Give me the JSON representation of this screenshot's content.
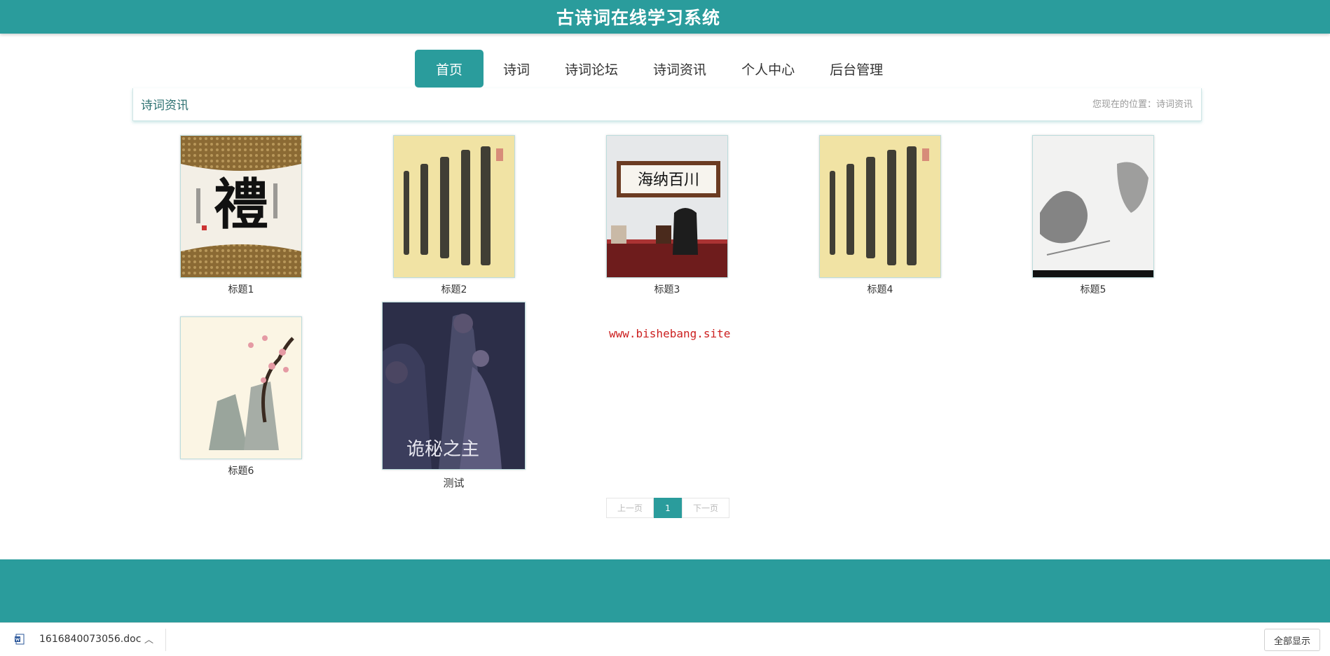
{
  "header": {
    "title": "古诗词在线学习系统"
  },
  "nav": {
    "items": [
      {
        "label": "首页"
      },
      {
        "label": "诗词"
      },
      {
        "label": "诗词论坛"
      },
      {
        "label": "诗词资讯"
      },
      {
        "label": "个人中心"
      },
      {
        "label": "后台管理"
      }
    ]
  },
  "breadcrumb": {
    "title": "诗词资讯",
    "path": "您现在的位置：诗词资讯"
  },
  "cards": [
    {
      "caption": "标题1",
      "image": "calligraphy-li-scroll"
    },
    {
      "caption": "标题2",
      "image": "calligraphy-yellow-scroll"
    },
    {
      "caption": "标题3",
      "image": "office-calligraphy-wall"
    },
    {
      "caption": "标题4",
      "image": "calligraphy-yellow-scroll"
    },
    {
      "caption": "标题5",
      "image": "ink-landscape-painting"
    },
    {
      "caption": "标题6",
      "image": "ink-plum-blossom-painting"
    },
    {
      "caption": "测试",
      "image": "anime-cover",
      "overlay_text": "诡秘之主"
    }
  ],
  "watermark": "www.bishebang.site",
  "pagination": {
    "prev": "上一页",
    "current": "1",
    "next": "下一页"
  },
  "download_bar": {
    "file_name": "1616840073056.doc",
    "show_all": "全部显示"
  },
  "colors": {
    "accent": "#2a9c9c",
    "watermark": "#cc1f1f"
  }
}
